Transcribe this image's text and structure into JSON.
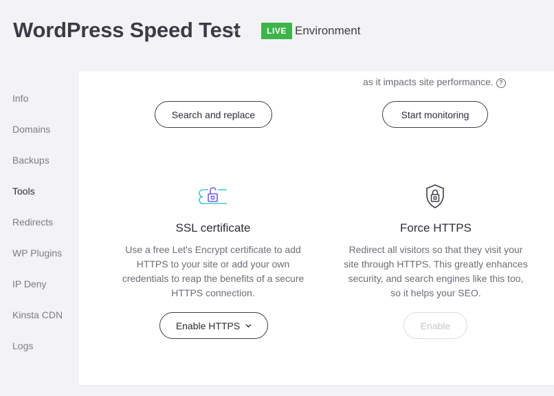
{
  "header": {
    "site_title": "WordPress Speed Test",
    "badge": "LIVE",
    "environment": "Environment",
    "badge_color": "#3db34a"
  },
  "sidebar": {
    "items": [
      {
        "label": "Info"
      },
      {
        "label": "Domains"
      },
      {
        "label": "Backups"
      },
      {
        "label": "Tools",
        "active": true
      },
      {
        "label": "Redirects"
      },
      {
        "label": "WP Plugins"
      },
      {
        "label": "IP Deny"
      },
      {
        "label": "Kinsta CDN"
      },
      {
        "label": "Logs"
      }
    ]
  },
  "tools": {
    "search_replace": {
      "button": "Search and replace"
    },
    "monitoring": {
      "partial_text": "as it impacts site performance.",
      "button": "Start monitoring",
      "icon": "help-icon"
    },
    "ssl": {
      "icon": "ssl-lock-icon",
      "title": "SSL certificate",
      "description": "Use a free Let's Encrypt certificate to add HTTPS to your site or add your own credentials to reap the benefits of a secure HTTPS connection.",
      "button": "Enable HTTPS"
    },
    "force_https": {
      "icon": "shield-lock-icon",
      "title": "Force HTTPS",
      "description": "Redirect all visitors so that they visit your site through HTTPS. This greatly enhances security, and search engines like this too, so it helps your SEO.",
      "button": "Enable",
      "button_disabled": true
    }
  }
}
